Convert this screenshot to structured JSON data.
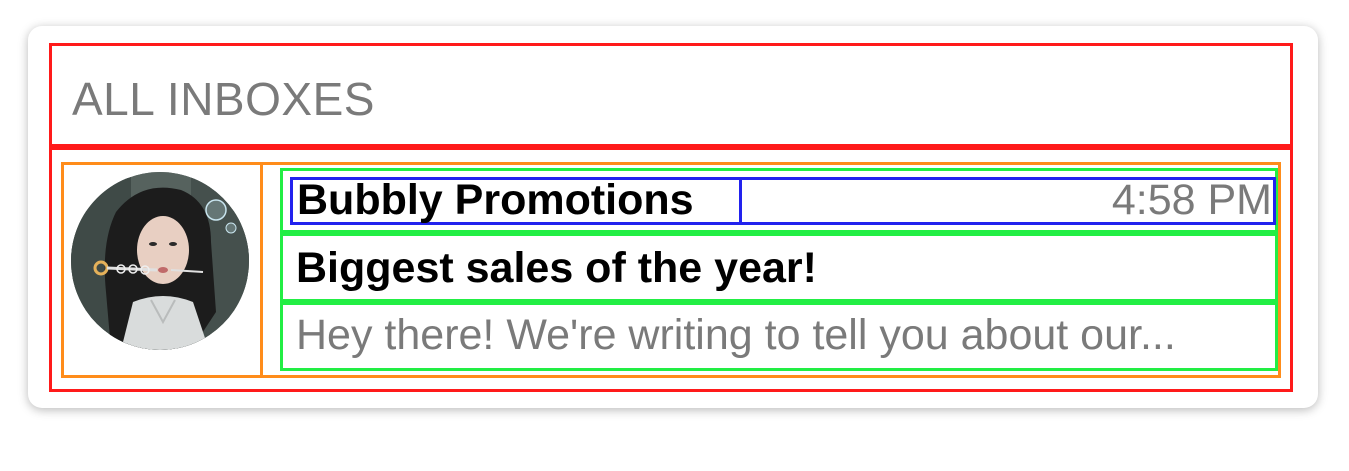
{
  "header": {
    "title": "ALL INBOXES"
  },
  "messages": [
    {
      "sender": "Bubbly Promotions",
      "time": "4:58 PM",
      "subject": "Biggest sales of the year!",
      "preview": "Hey there! We're writing to tell you about our...",
      "avatar_icon": "person-blowing-bubbles-photo"
    }
  ],
  "colors": {
    "header_text": "#7a7a7a",
    "sender_text": "#000000",
    "preview_text": "#7a7a7a",
    "outline_red": "#ff1a1a",
    "outline_orange": "#ff8c1a",
    "outline_green": "#22ee44",
    "outline_blue": "#2222ee"
  }
}
